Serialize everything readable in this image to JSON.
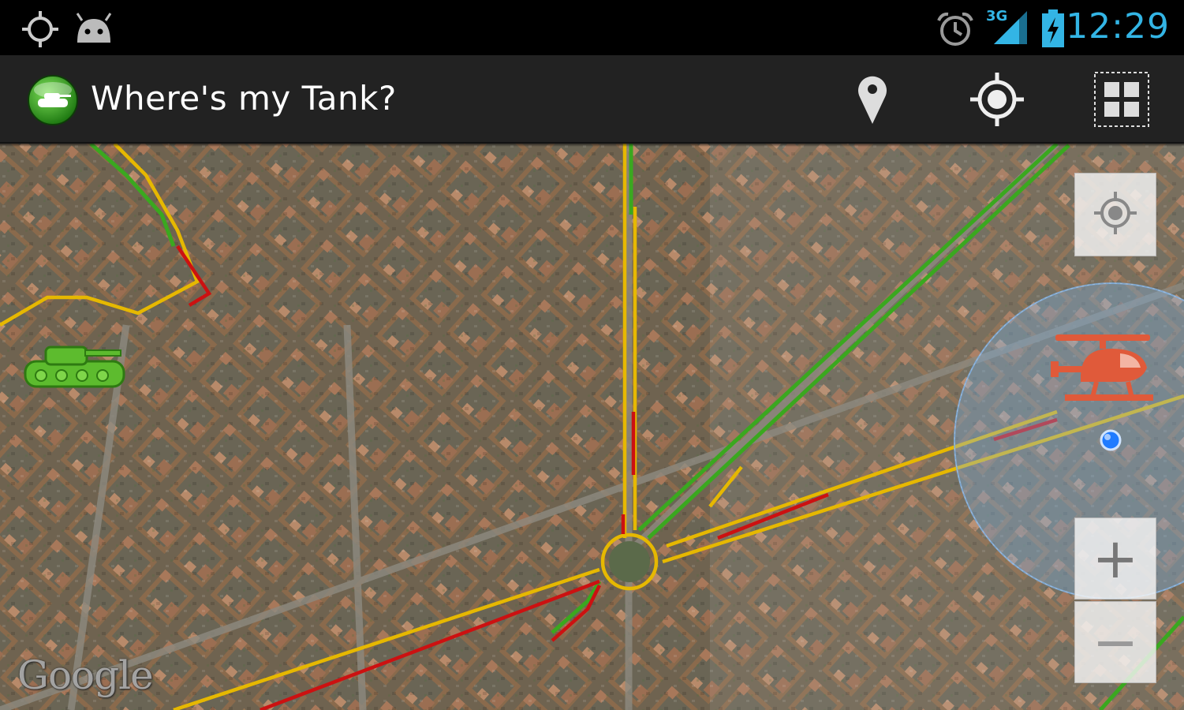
{
  "status_bar": {
    "time": "12:29",
    "network": "3G",
    "icons": [
      "gps-icon",
      "android-icon",
      "alarm-icon",
      "signal-icon",
      "battery-charging-icon"
    ]
  },
  "action_bar": {
    "title": "Where's my Tank?",
    "app_icon": "tank-app-icon",
    "actions": [
      "place-marker-icon",
      "my-location-icon",
      "grid-icon"
    ]
  },
  "map": {
    "attribution": "Google",
    "controls": {
      "locate": "my-location-icon",
      "zoom_in": "+",
      "zoom_out": "−"
    },
    "markers": [
      "tank-marker",
      "helicopter-marker",
      "current-location-dot"
    ]
  },
  "colors": {
    "accent": "#33b5e5",
    "action_bar": "#222222",
    "traffic_green": "#3aa81f",
    "traffic_yellow": "#e6b800",
    "traffic_red": "#cc1111",
    "tank": "#5dbb2e",
    "helicopter": "#e05a3a",
    "accuracy_circle": "#7fb2e6"
  }
}
